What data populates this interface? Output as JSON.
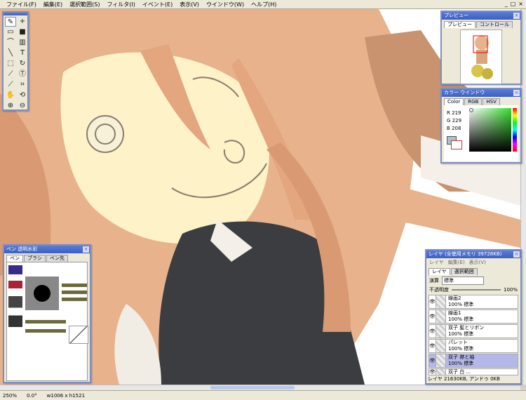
{
  "menu": [
    "ファイル(F)",
    "編集(E)",
    "選択範囲(S)",
    "フィルタ(I)",
    "イベント(E)",
    "表示(V)",
    "ウインドウ(W)",
    "ヘルプ(H)"
  ],
  "window_controls": [
    "_",
    "□",
    "×"
  ],
  "status": {
    "zoom": "250%",
    "angle": "0.0°",
    "size": "w1006 x h1521"
  },
  "panels": {
    "preview": {
      "title": "プレビュー",
      "tabs": [
        "プレビュー",
        "コントロール"
      ]
    },
    "color": {
      "title": "カラー ウインドウ",
      "tabs": [
        "Color",
        "RGB",
        "HSV"
      ],
      "values": [
        {
          "label": "R",
          "value": "219"
        },
        {
          "label": "G",
          "value": "229"
        },
        {
          "label": "B",
          "value": "208"
        }
      ],
      "current_color": "#dbe5d0"
    },
    "pen": {
      "title": "ペン 透明水彩",
      "tabs": [
        "ペン",
        "ブラシ",
        "ペン先"
      ]
    },
    "layer": {
      "title": "レイヤ (全使用メモリ 39728KB)",
      "menu": [
        "レイヤ",
        "編集(E)",
        "表示(V)"
      ],
      "tabs": [
        "レイヤ",
        "選択範囲"
      ],
      "blend_label": "演算",
      "blend_value": "標準",
      "opacity_label": "不透明度",
      "opacity_value": "100%",
      "layers": [
        {
          "name": "線画2",
          "info": "100% 標準",
          "selected": false
        },
        {
          "name": "線画1",
          "info": "100% 標準",
          "selected": false
        },
        {
          "name": "双子 髪とリボン",
          "info": "100% 標準",
          "selected": false
        },
        {
          "name": "パレット",
          "info": "100% 標準",
          "selected": false
        },
        {
          "name": "双子 襟と袖",
          "info": "100% 標準",
          "selected": true
        },
        {
          "name": "双子 白 ...",
          "info": "",
          "selected": false
        }
      ],
      "footer": "レイヤ 21630KB, アンドゥ 0KB"
    }
  }
}
